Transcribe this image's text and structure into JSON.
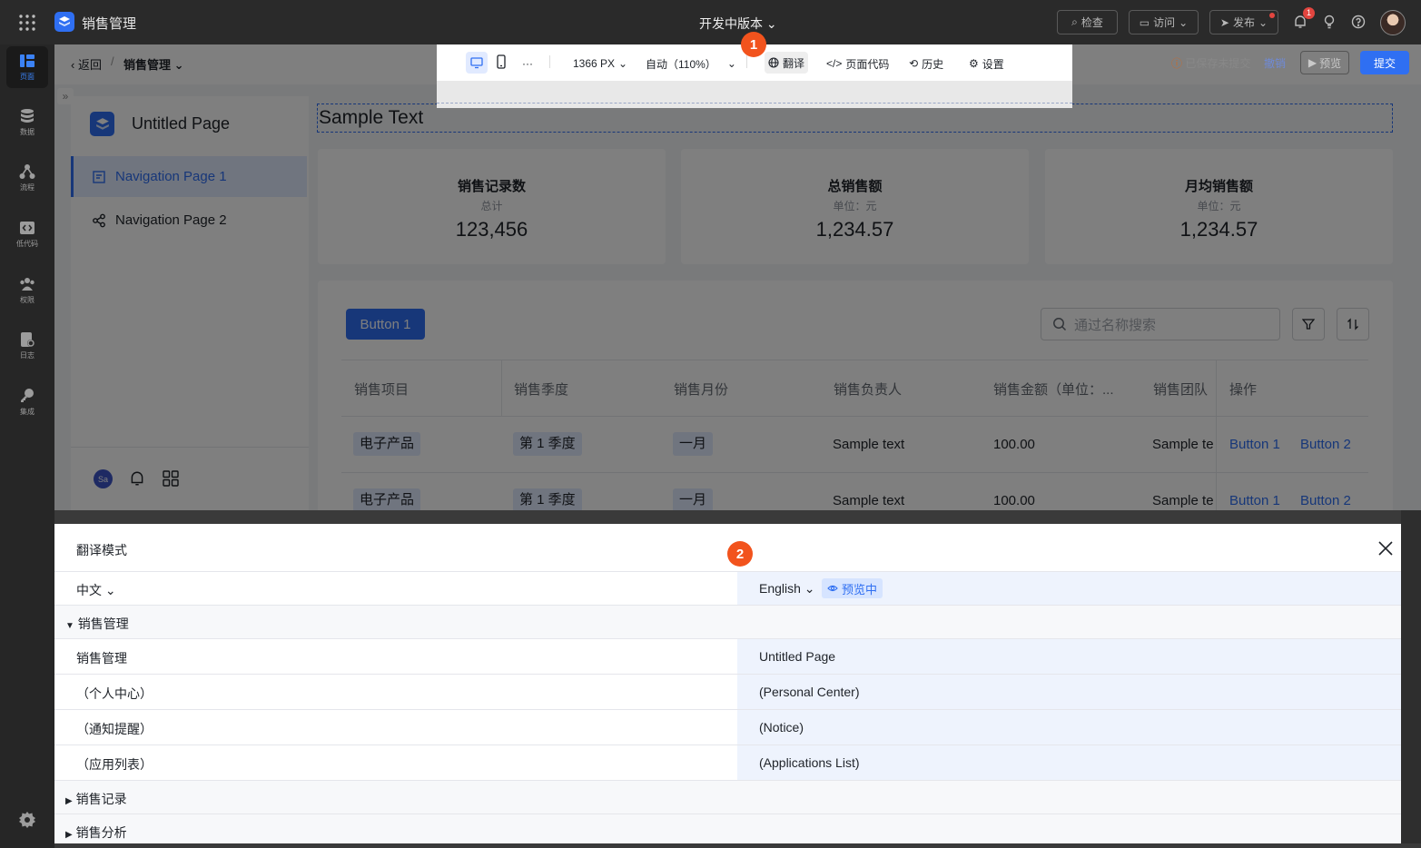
{
  "app": {
    "name": "销售管理",
    "version": "开发中版本"
  },
  "topbar": {
    "inspect": "检查",
    "visit": "访问",
    "publish": "发布",
    "notif_count": "1"
  },
  "rail": [
    "页面",
    "数据",
    "流程",
    "低代码",
    "权限",
    "日志",
    "集成"
  ],
  "breadcrumb": {
    "back": "返回",
    "sep": "/",
    "current": "销售管理"
  },
  "status": {
    "saved": "已保存未提交",
    "undo": "撤销",
    "preview": "预览",
    "submit": "提交"
  },
  "toolbar": {
    "width": "1366 PX",
    "zoom": "自动（110%）",
    "translate": "翻译",
    "code": "页面代码",
    "history": "历史",
    "settings": "设置",
    "more": "···"
  },
  "markers": [
    "1",
    "2"
  ],
  "page": {
    "title": "Untitled Page",
    "nav": [
      "Navigation Page 1",
      "Navigation Page 2"
    ],
    "user_initials": "Sa",
    "sample_text": "Sample Text",
    "stats": [
      {
        "title": "销售记录数",
        "sub": "总计",
        "value": "123,456"
      },
      {
        "title": "总销售额",
        "sub": "单位：元",
        "value": "1,234.57"
      },
      {
        "title": "月均销售额",
        "sub": "单位：元",
        "value": "1,234.57"
      }
    ],
    "button1": "Button 1",
    "search_placeholder": "通过名称搜索",
    "columns": [
      "销售项目",
      "销售季度",
      "销售月份",
      "销售负责人",
      "销售金额（单位：...",
      "销售团队",
      "操作"
    ],
    "rows": [
      {
        "item": "电子产品",
        "quarter": "第 1 季度",
        "month": "一月",
        "owner": "Sample text",
        "amount": "100.00",
        "team": "Sample te",
        "a1": "Button 1",
        "a2": "Button 2"
      },
      {
        "item": "电子产品",
        "quarter": "第 1 季度",
        "month": "一月",
        "owner": "Sample text",
        "amount": "100.00",
        "team": "Sample te",
        "a1": "Button 1",
        "a2": "Button 2"
      }
    ]
  },
  "translate": {
    "title": "翻译模式",
    "source_lang": "中文",
    "target_lang": "English",
    "previewing": "预览中",
    "group1": "销售管理",
    "entries": [
      {
        "src": "销售管理",
        "dst": "Untitled Page"
      },
      {
        "src": "（个人中心）",
        "dst": "(Personal Center)"
      },
      {
        "src": "（通知提醒）",
        "dst": "(Notice)"
      },
      {
        "src": "（应用列表）",
        "dst": "(Applications List)"
      }
    ],
    "group2": "销售记录",
    "group3": "销售分析"
  }
}
